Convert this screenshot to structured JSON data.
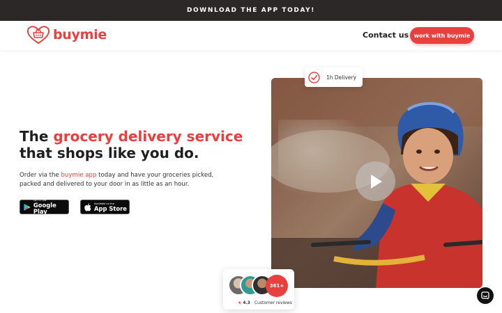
{
  "topbar": {
    "text": "DOWNLOAD THE APP TODAY!"
  },
  "header": {
    "logo_text": "buymie",
    "contact_label": "Contact us",
    "cta_label": "work with buymie"
  },
  "hero": {
    "title_part1": "The ",
    "title_highlight": "grocery delivery service",
    "title_part2": "that shops like you do.",
    "desc_before": "Order via the ",
    "desc_link": "buymie app",
    "desc_after": " today and have your groceries picked, packed and delivered to your door in as little as an hour.",
    "google_play": {
      "small": "GET IT ON",
      "big": "Google Play"
    },
    "app_store": {
      "small": "Available on the",
      "big": "App Store"
    }
  },
  "delivery_badge": {
    "label": "1h Delivery"
  },
  "reviews": {
    "count": "361+",
    "rating": "4.3",
    "label": "Customer reviews"
  },
  "colors": {
    "brand": "#e8403f",
    "topbar": "#2b2827",
    "text": "#1f1f1f"
  },
  "icons": [
    "basket-heart-logo-icon",
    "check-circle-icon",
    "play-icon",
    "google-play-icon",
    "apple-icon",
    "star-icon",
    "chat-icon"
  ]
}
